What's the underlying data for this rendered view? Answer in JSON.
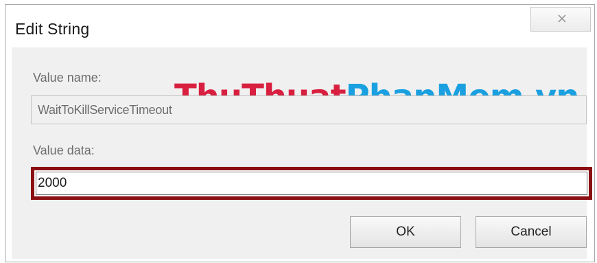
{
  "window": {
    "title": "Edit String",
    "close_icon": "close-icon"
  },
  "watermark": {
    "part1": "ThuThuat",
    "part2": "PhanMem.vn",
    "color1": "#d81f3f",
    "color2": "#1aa0e0"
  },
  "form": {
    "value_name_label": "Value name:",
    "value_name": "WaitToKillServiceTimeout",
    "value_data_label": "Value data:",
    "value_data": "2000",
    "highlight_color": "#8b0e12"
  },
  "buttons": {
    "ok_label": "OK",
    "cancel_label": "Cancel"
  }
}
